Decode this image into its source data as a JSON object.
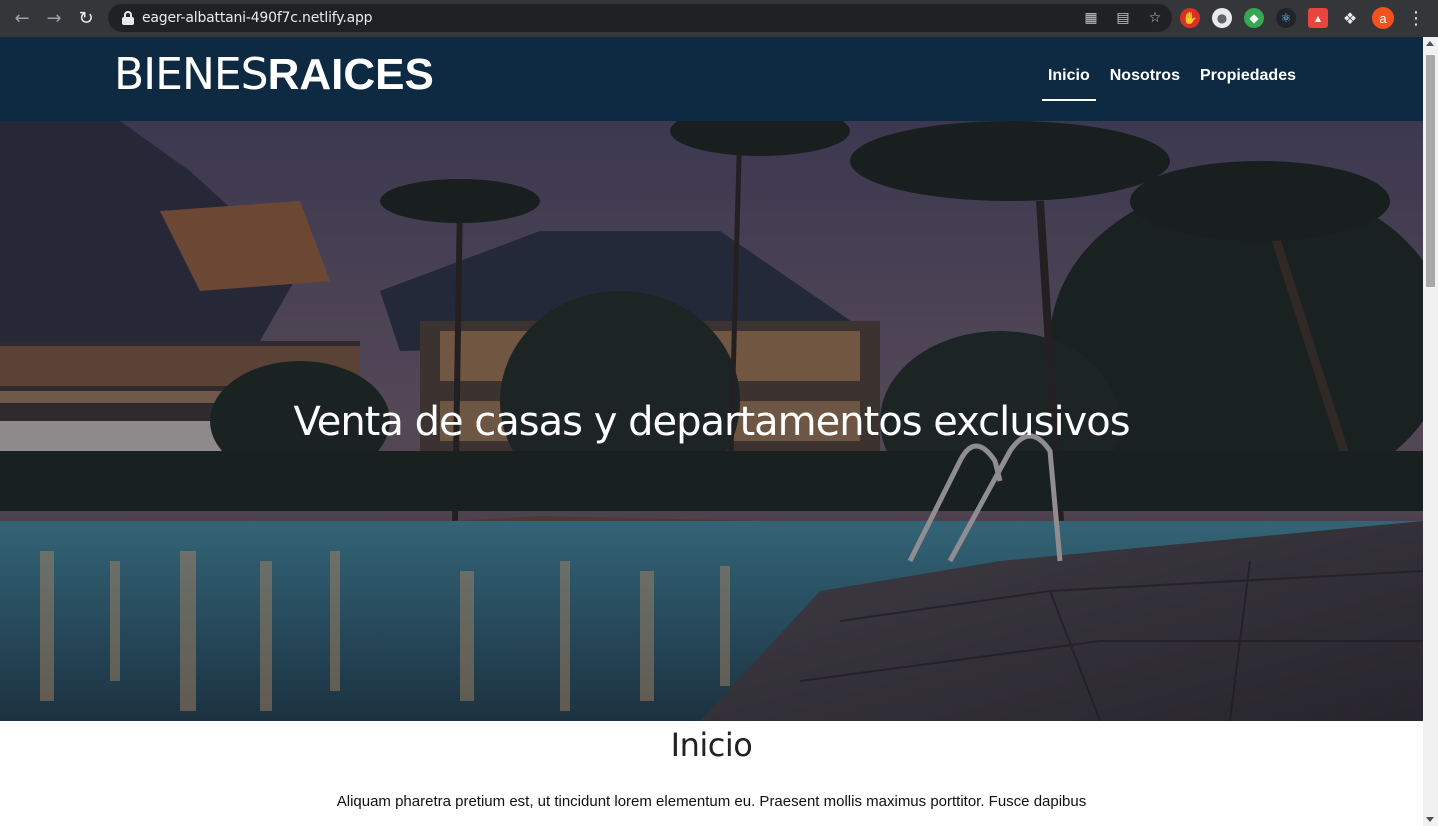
{
  "browser": {
    "url": "eager-albattani-490f7c.netlify.app",
    "avatar_letter": "a"
  },
  "site": {
    "logo_light": "BIENES",
    "logo_bold": "RAICES",
    "nav": [
      {
        "label": "Inicio",
        "active": true
      },
      {
        "label": "Nosotros",
        "active": false
      },
      {
        "label": "Propiedades",
        "active": false
      }
    ]
  },
  "hero": {
    "title": "Venta de casas y departamentos exclusivos"
  },
  "content": {
    "section_title": "Inicio",
    "paragraph": "Aliquam pharetra pretium est, ut tincidunt lorem elementum eu. Praesent mollis maximus porttitor. Fusce dapibus"
  },
  "colors": {
    "header_bg": "#0d2a42",
    "chrome_bg": "#35363a"
  }
}
